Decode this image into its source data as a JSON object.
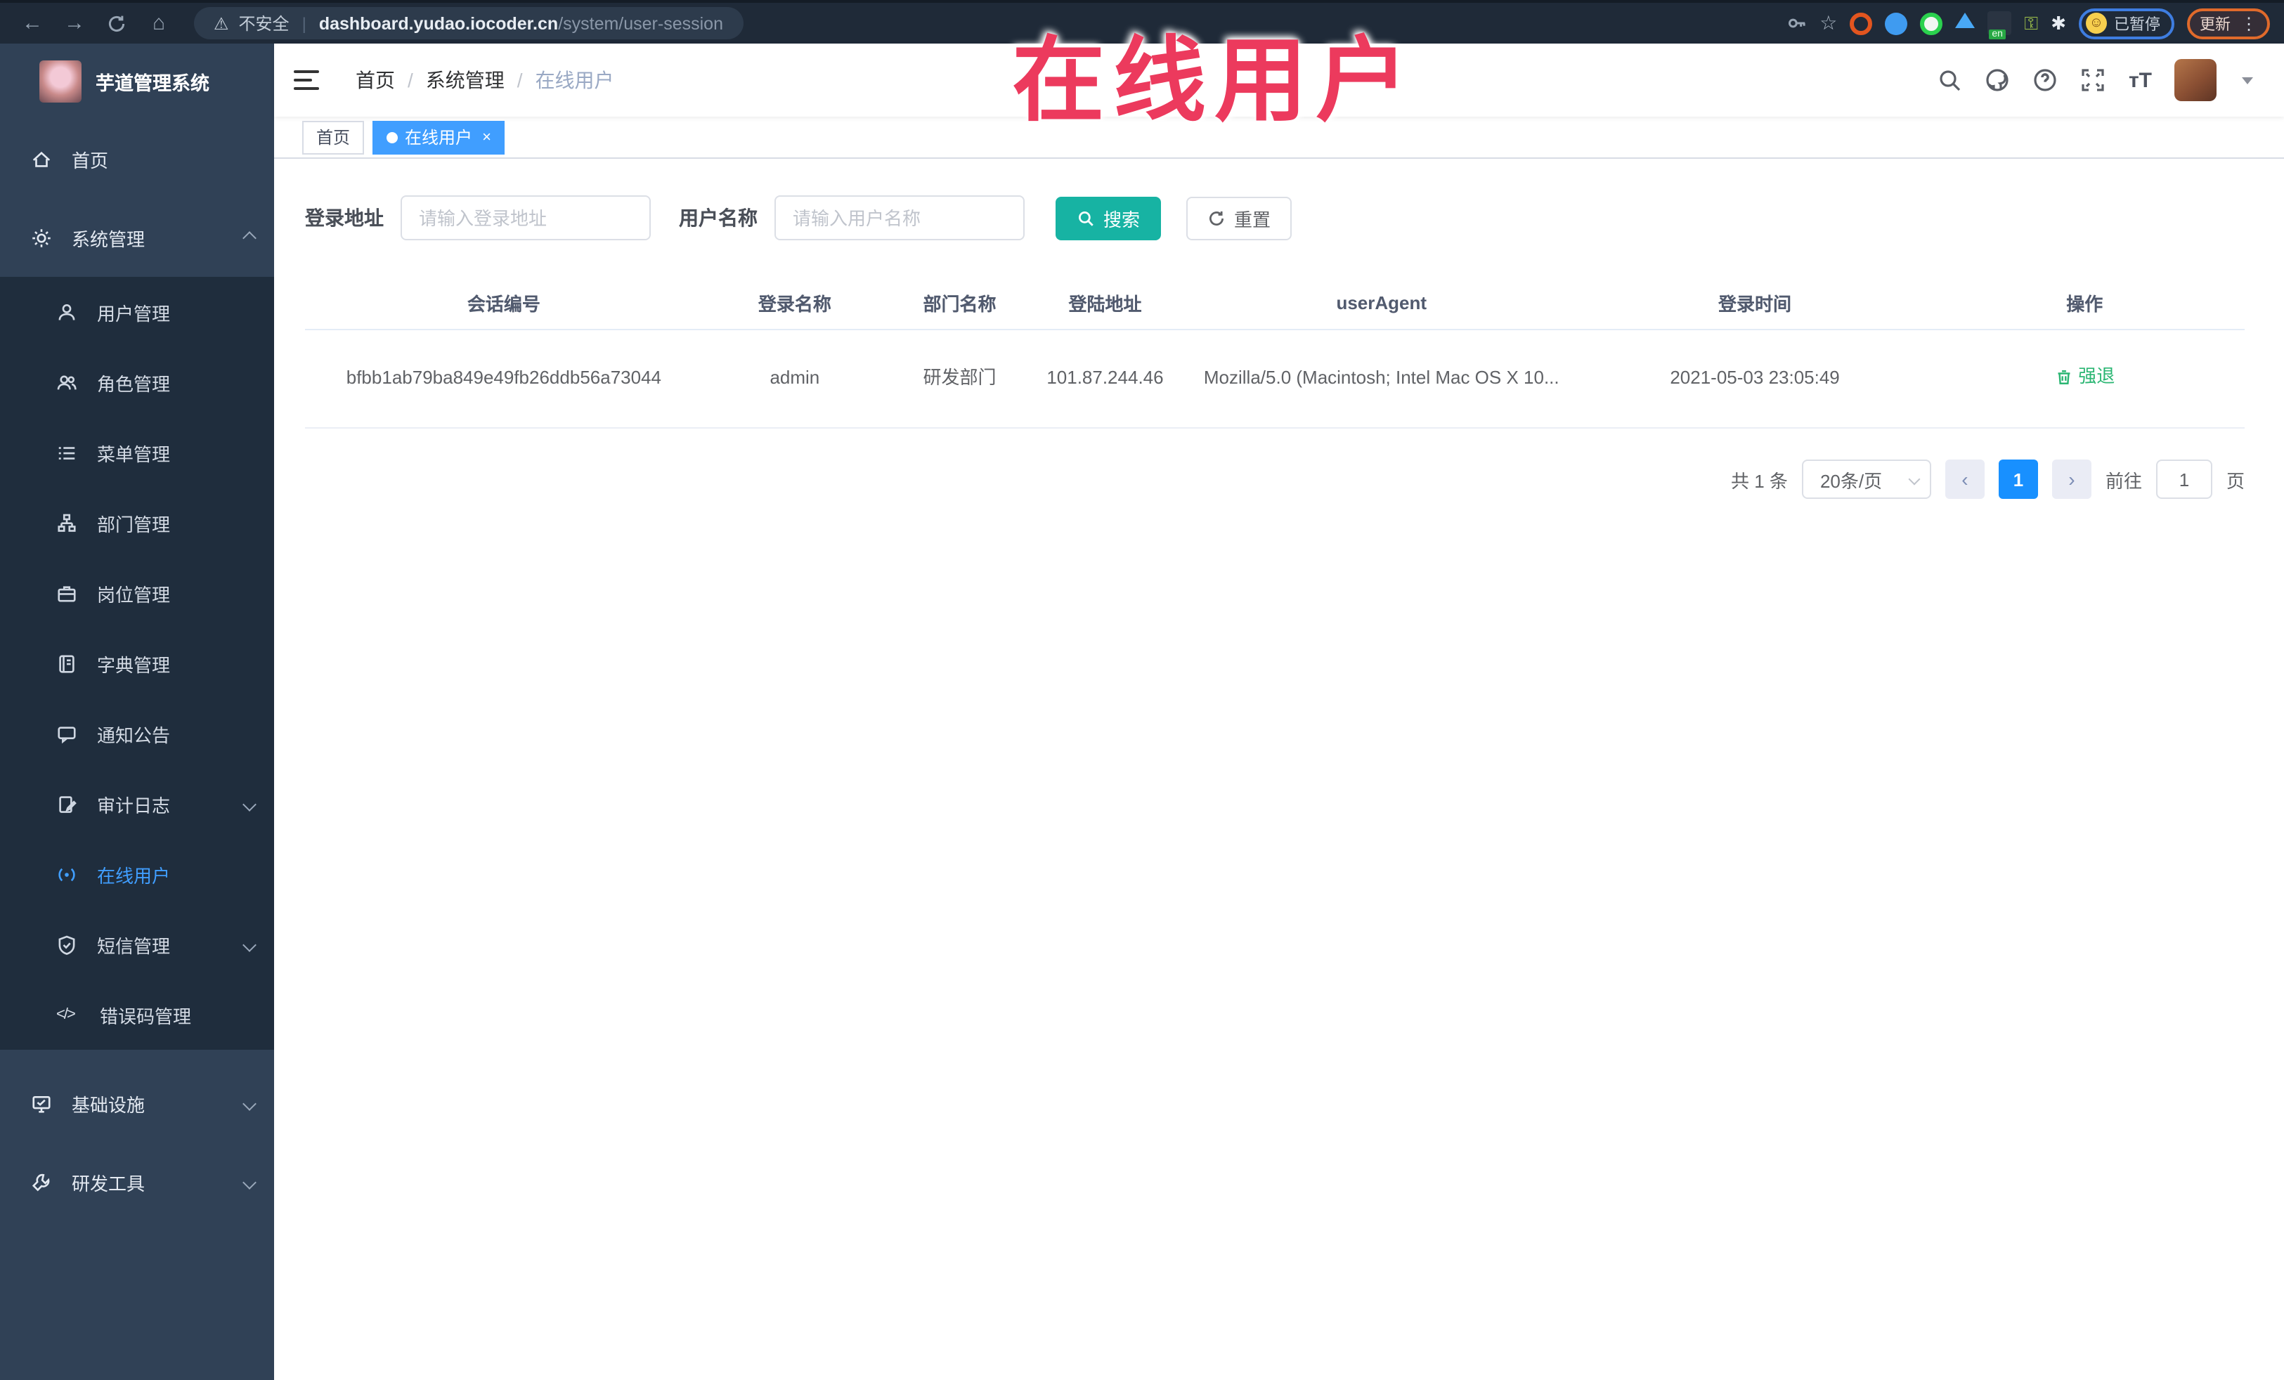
{
  "browser": {
    "security_label": "不安全",
    "url_domain": "dashboard.yudao.iocoder.cn",
    "url_path": "/system/user-session",
    "extension_badge": "en",
    "paused_badge": "已暂停",
    "update_button": "更新"
  },
  "annotation": {
    "text": "在线用户",
    "color": "#ec3a5d"
  },
  "sidebar": {
    "title": "芋道管理系统",
    "menu": [
      {
        "label": "首页",
        "icon": "home-icon"
      },
      {
        "label": "系统管理",
        "icon": "gear-icon",
        "state": "expanded",
        "children": [
          {
            "label": "用户管理",
            "icon": "user-icon"
          },
          {
            "label": "角色管理",
            "icon": "users-icon"
          },
          {
            "label": "菜单管理",
            "icon": "list-icon"
          },
          {
            "label": "部门管理",
            "icon": "tree-icon"
          },
          {
            "label": "岗位管理",
            "icon": "briefcase-icon"
          },
          {
            "label": "字典管理",
            "icon": "book-icon"
          },
          {
            "label": "通知公告",
            "icon": "megaphone-icon"
          },
          {
            "label": "审计日志",
            "icon": "clipboard-icon",
            "state": "collapsed"
          },
          {
            "label": "在线用户",
            "icon": "online-icon",
            "active": true
          },
          {
            "label": "短信管理",
            "icon": "shield-icon",
            "state": "collapsed"
          },
          {
            "label": "错误码管理",
            "icon": "code-icon"
          }
        ]
      },
      {
        "label": "基础设施",
        "icon": "monitor-icon",
        "state": "collapsed"
      },
      {
        "label": "研发工具",
        "icon": "wrench-icon",
        "state": "collapsed"
      }
    ]
  },
  "header": {
    "breadcrumb": [
      "首页",
      "系统管理",
      "在线用户"
    ]
  },
  "tabs": [
    {
      "label": "首页",
      "active": false
    },
    {
      "label": "在线用户",
      "active": true
    }
  ],
  "filters": {
    "address_label": "登录地址",
    "address_placeholder": "请输入登录地址",
    "username_label": "用户名称",
    "username_placeholder": "请输入用户名称",
    "search_label": "搜索",
    "reset_label": "重置"
  },
  "table": {
    "columns": [
      "会话编号",
      "登录名称",
      "部门名称",
      "登陆地址",
      "userAgent",
      "登录时间",
      "操作"
    ],
    "rows": [
      {
        "session_id": "bfbb1ab79ba849e49fb26ddb56a73044",
        "username": "admin",
        "dept": "研发部门",
        "ip": "101.87.244.46",
        "user_agent": "Mozilla/5.0 (Macintosh; Intel Mac OS X 10...",
        "login_time": "2021-05-03 23:05:49",
        "action": "强退"
      }
    ]
  },
  "pagination": {
    "total_label": "共 1 条",
    "page_size": "20条/页",
    "current_page": "1",
    "goto_label": "前往",
    "goto_value": "1",
    "page_unit": "页"
  },
  "colors": {
    "sidebar_bg": "#304156",
    "submenu_bg": "#1f2d3d",
    "active_menu": "#409EFF",
    "active_tab_bg": "#409EFF",
    "search_button": "#17b3a3",
    "action_link": "#2bb673",
    "pager_active": "#1890ff",
    "annotation_red": "#ec3a5d",
    "browser_bar_bg": "#1f2a38"
  }
}
